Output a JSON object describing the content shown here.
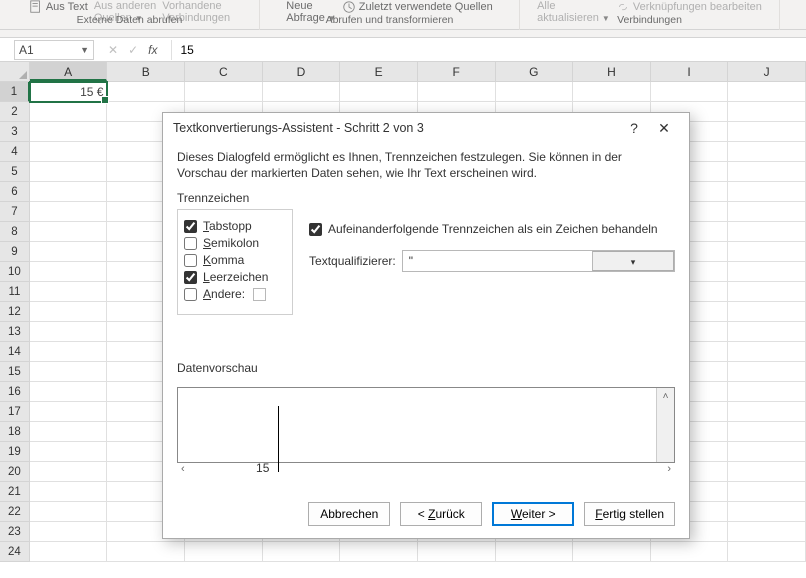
{
  "ribbon": {
    "group1": {
      "item1": "Aus Text",
      "item2_line1": "Aus anderen",
      "item2_line2": "Quellen",
      "item3_line1": "Vorhandene",
      "item3_line2": "Verbindungen",
      "label": "Externe Daten abrufen"
    },
    "group2": {
      "item1_line1": "Neue",
      "item1_line2": "Abfrage",
      "item2": "Zuletzt verwendete Quellen",
      "label": "Abrufen und transformieren"
    },
    "group3": {
      "item1_line1": "Alle",
      "item1_line2": "aktualisieren",
      "item2": "Verknüpfungen bearbeiten",
      "label": "Verbindungen"
    }
  },
  "formula": {
    "cellref": "A1",
    "value": "15"
  },
  "grid": {
    "cols": [
      "A",
      "B",
      "C",
      "D",
      "E",
      "F",
      "G",
      "H",
      "I",
      "J"
    ],
    "rows": 24,
    "a1": "15 €"
  },
  "dialog": {
    "title": "Textkonvertierungs-Assistent - Schritt 2 von 3",
    "intro": "Dieses Dialogfeld ermöglicht es Ihnen, Trennzeichen festzulegen. Sie können in der Vorschau der markierten Daten sehen, wie Ihr Text erscheinen wird.",
    "delim_label": "Trennzeichen",
    "delims": {
      "tab": {
        "label_pre": "T",
        "label_rest": "abstopp",
        "checked": true
      },
      "semicolon": {
        "label_pre": "S",
        "label_rest": "emikolon",
        "checked": false
      },
      "comma": {
        "label_pre": "K",
        "label_rest": "omma",
        "checked": false
      },
      "space": {
        "label_pre": "L",
        "label_rest": "eerzeichen",
        "checked": true
      },
      "other": {
        "label_pre": "A",
        "label_rest": "ndere:",
        "checked": false,
        "value": ""
      }
    },
    "consecutive": {
      "label": "Aufeinanderfolgende Trennzeichen als ein Zeichen behandeln",
      "checked": true
    },
    "qualifier_label_pre": "Te",
    "qualifier_label_u": "x",
    "qualifier_label_post": "tqualifizierer:",
    "qualifier_value": "\"",
    "preview_label_pre": "Daten",
    "preview_label_u": "v",
    "preview_label_post": "orschau",
    "preview_col1": "15",
    "preview_col2": "",
    "buttons": {
      "cancel": "Abbrechen",
      "back_pre": "< ",
      "back_u": "Z",
      "back_post": "urück",
      "next_pre": "W",
      "next_post": "eiter >",
      "finish_pre": "F",
      "finish_post": "ertig stellen"
    }
  }
}
